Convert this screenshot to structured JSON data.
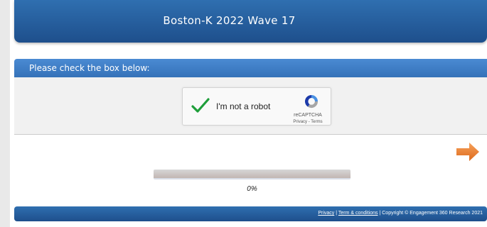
{
  "header": {
    "title": "Boston-K 2022 Wave 17"
  },
  "question": {
    "prompt": "Please check the box below:"
  },
  "recaptcha": {
    "label": "I'm not a robot",
    "brand": "reCAPTCHA",
    "privacy_link": "Privacy",
    "separator": " - ",
    "terms_link": "Terms",
    "checked": true,
    "check_icon": "checkmark-icon",
    "logo_icon": "recaptcha-logo-icon"
  },
  "navigation": {
    "next_icon": "right-arrow-icon",
    "accent_color": "#e8782a"
  },
  "progress": {
    "value": 0,
    "text": "0%"
  },
  "footer": {
    "privacy_link": "Privacy",
    "sep1": " | ",
    "terms_link": "Term & conditions",
    "sep2": " | ",
    "copyright": "Copyright © Engagement 360 Research 2021"
  }
}
